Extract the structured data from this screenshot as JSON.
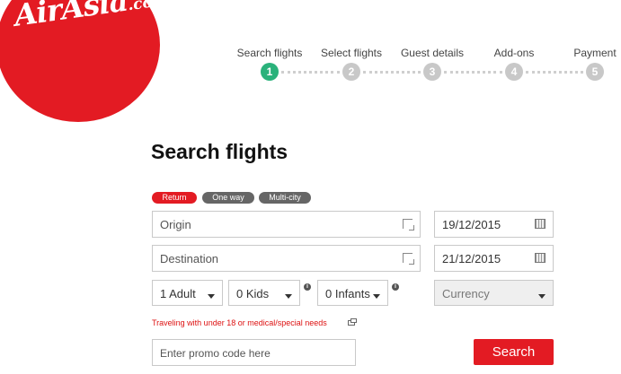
{
  "logo": {
    "main": "AirAsia",
    "suffix": ".com"
  },
  "steps": [
    {
      "label": "Search flights",
      "number": "1",
      "active": true
    },
    {
      "label": "Select flights",
      "number": "2",
      "active": false
    },
    {
      "label": "Guest details",
      "number": "3",
      "active": false
    },
    {
      "label": "Add-ons",
      "number": "4",
      "active": false
    },
    {
      "label": "Payment",
      "number": "5",
      "active": false
    }
  ],
  "page_title": "Search flights",
  "trip_types": [
    {
      "label": "Return",
      "selected": true,
      "color": "#e31b23"
    },
    {
      "label": "One way",
      "selected": false,
      "color": "#666666"
    },
    {
      "label": "Multi-city",
      "selected": false,
      "color": "#666666"
    }
  ],
  "origin": {
    "placeholder": "Origin"
  },
  "destination": {
    "placeholder": "Destination"
  },
  "depart_date": "19/12/2015",
  "return_date": "21/12/2015",
  "passengers": {
    "adults": "1 Adult",
    "kids": "0 Kids",
    "infants": "0 Infants"
  },
  "currency": {
    "placeholder": "Currency"
  },
  "notice": "Traveling with under 18 or medical/special needs",
  "promo": {
    "placeholder": "Enter promo code here"
  },
  "search_button": "Search",
  "colors": {
    "brand": "#e31b23",
    "step_active": "#2ab27b",
    "step_inactive": "#c8c8c8"
  }
}
